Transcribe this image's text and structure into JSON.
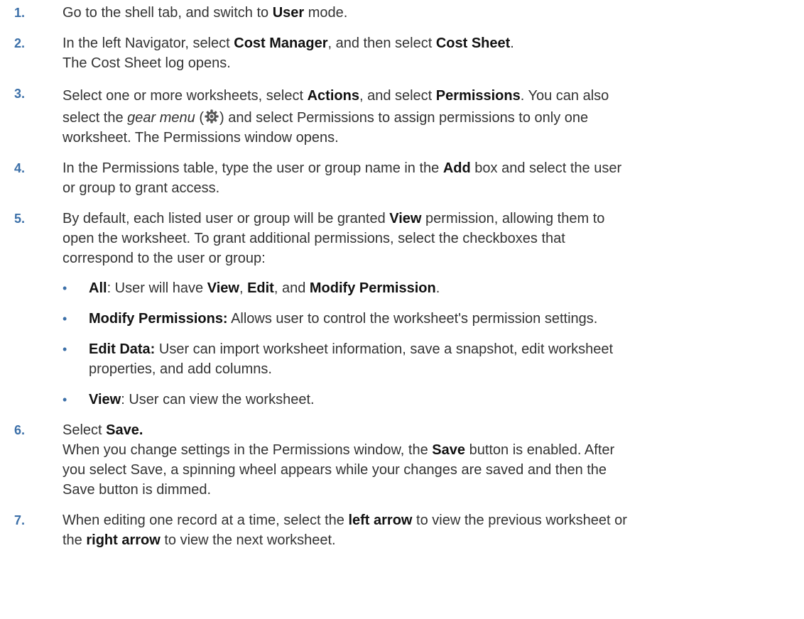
{
  "steps": [
    {
      "num": "1.",
      "parts": [
        "Go to the shell tab, and switch to ",
        "User",
        " mode."
      ]
    },
    {
      "num": "2.",
      "parts": [
        "In the left Navigator, select ",
        "Cost Manager",
        ", and then select ",
        "Cost Sheet",
        "."
      ],
      "line2": "The Cost Sheet log opens."
    },
    {
      "num": "3.",
      "parts": [
        "Select one or more worksheets, select ",
        "Actions",
        ", and select ",
        "Permissions",
        ". You can also"
      ],
      "line2a": "select the ",
      "gear_menu": "gear menu",
      "line2b": " (",
      "line2c": ") and select Permissions to assign permissions to only one",
      "line3": "worksheet. The Permissions window opens."
    },
    {
      "num": "4.",
      "parts": [
        "In the Permissions table, type the user or group name in the ",
        "Add",
        " box and select the user"
      ],
      "line2": "or group to grant access."
    },
    {
      "num": "5.",
      "parts": [
        "By default, each listed user or group will be granted ",
        "View",
        " permission, allowing them to"
      ],
      "line2": "open the worksheet. To grant additional permissions, select the checkboxes that",
      "line3": "correspond to the user or group:",
      "bullets": [
        {
          "term": "All",
          "rest_a": ": User will have ",
          "b1": "View",
          "rest_b": ", ",
          "b2": "Edit",
          "rest_c": ", and ",
          "b3": "Modify Permission",
          "rest_d": "."
        },
        {
          "term": "Modify Permissions:",
          "rest_a": " Allows user to control the worksheet's permission settings."
        },
        {
          "term": "Edit Data:",
          "rest_a": " User can import worksheet information, save a snapshot, edit worksheet",
          "line2": "properties, and add columns."
        },
        {
          "term": "View",
          "rest_a": ": User can view the worksheet."
        }
      ]
    },
    {
      "num": "6.",
      "parts": [
        "Select ",
        "Save."
      ],
      "line2_parts": [
        "When you change settings in the Permissions window, the ",
        "Save",
        " button is enabled. After"
      ],
      "line3": "you select Save, a spinning wheel appears while your changes are saved and then the",
      "line4": "Save button is dimmed."
    },
    {
      "num": "7.",
      "parts": [
        "When editing one record at a time, select the ",
        "left arrow",
        " to view the previous worksheet or"
      ],
      "line2_parts": [
        "the ",
        "right arrow",
        " to view the next worksheet."
      ]
    }
  ],
  "colors": {
    "number_accent": "#3b6fa8",
    "body_text": "#333333"
  },
  "icons": {
    "gear": "gear-icon"
  }
}
